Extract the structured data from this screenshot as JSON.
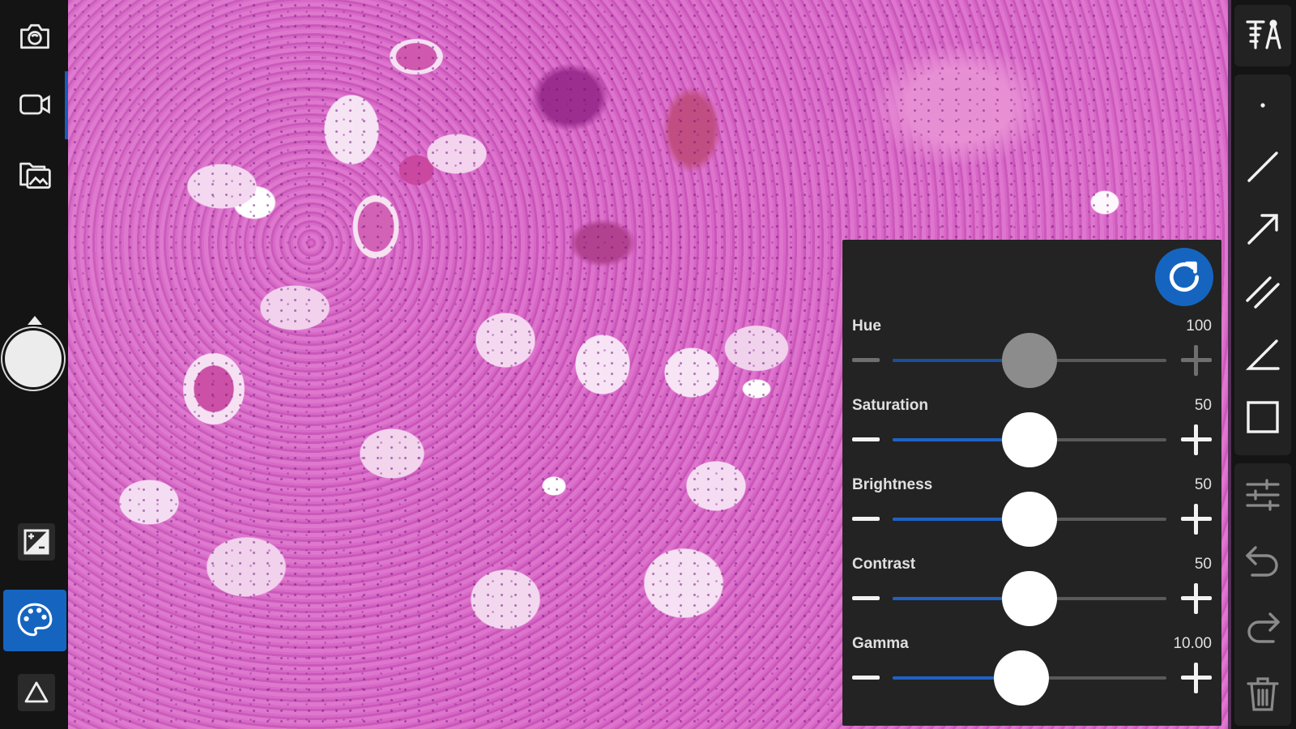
{
  "left_toolbar": {
    "items": [
      {
        "name": "camera-snapshot-icon"
      },
      {
        "name": "video-camera-icon"
      },
      {
        "name": "gallery-folder-icon"
      },
      {
        "name": "exposure-icon"
      },
      {
        "name": "palette-icon"
      },
      {
        "name": "warning-triangle-icon"
      }
    ],
    "active_color": "#1565c0"
  },
  "right_toolbar": {
    "items": [
      {
        "name": "measurement-tools-icon"
      },
      {
        "name": "point-tool-icon"
      },
      {
        "name": "line-tool-icon"
      },
      {
        "name": "arrow-tool-icon"
      },
      {
        "name": "parallel-lines-tool-icon"
      },
      {
        "name": "angle-tool-icon"
      },
      {
        "name": "rectangle-tool-icon"
      },
      {
        "name": "settings-sliders-icon"
      },
      {
        "name": "undo-icon"
      },
      {
        "name": "redo-icon"
      },
      {
        "name": "delete-trash-icon"
      }
    ]
  },
  "adjust_panel": {
    "reset_icon": "reset-refresh-icon",
    "accent_color": "#1565c0",
    "sliders": [
      {
        "key": "hue",
        "label": "Hue",
        "value": "100",
        "level": 0.5,
        "enabled": false
      },
      {
        "key": "saturation",
        "label": "Saturation",
        "value": "50",
        "level": 0.5,
        "enabled": true
      },
      {
        "key": "brightness",
        "label": "Brightness",
        "value": "50",
        "level": 0.5,
        "enabled": true
      },
      {
        "key": "contrast",
        "label": "Contrast",
        "value": "50",
        "level": 0.5,
        "enabled": true
      },
      {
        "key": "gamma",
        "label": "Gamma",
        "value": "10.00",
        "level": 0.47,
        "enabled": true
      }
    ]
  }
}
